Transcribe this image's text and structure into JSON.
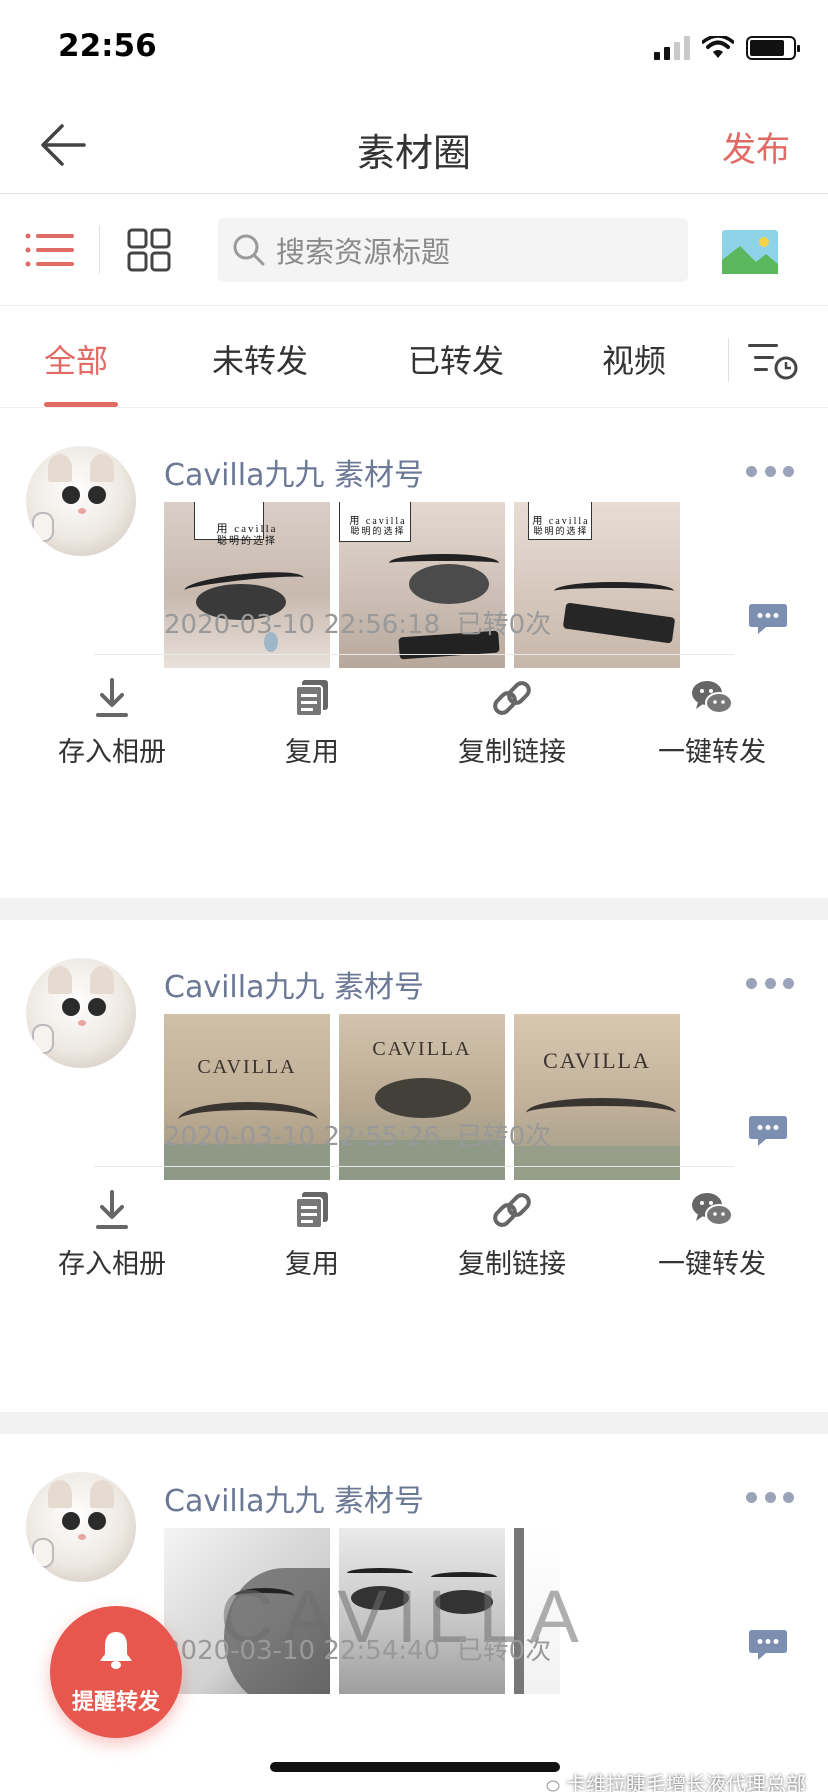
{
  "status_bar": {
    "time": "22:56"
  },
  "nav": {
    "title": "素材圈",
    "publish_label": "发布"
  },
  "search": {
    "placeholder": "搜索资源标题"
  },
  "tabs": [
    {
      "label": "全部",
      "active": true
    },
    {
      "label": "未转发",
      "active": false
    },
    {
      "label": "已转发",
      "active": false
    },
    {
      "label": "视频",
      "active": false
    }
  ],
  "actions": {
    "save_label": "存入相册",
    "reuse_label": "复用",
    "copy_link_label": "复制链接",
    "forward_label": "一键转发"
  },
  "posts": [
    {
      "author": "Cavilla九九 素材号",
      "time": "2020-03-10 22:56:18",
      "forwards": "已转0次",
      "images": [
        {
          "overlay_top": "用 cavilla",
          "overlay_bottom": "聪明的选择"
        },
        {
          "overlay_top": "用 cavilla",
          "overlay_bottom": "聪明的选择"
        },
        {
          "overlay_top": "用 cavilla",
          "overlay_bottom": "聪明的选择"
        }
      ]
    },
    {
      "author": "Cavilla九九 素材号",
      "time": "2020-03-10 22:55:26",
      "forwards": "已转0次",
      "images": [
        {
          "brand": "CAVILLA"
        },
        {
          "brand": "CAVILLA"
        },
        {
          "brand": "CAVILLA"
        }
      ]
    },
    {
      "author": "Cavilla九九 素材号",
      "time": "2020-03-10 22:54:40",
      "forwards": "已转0次",
      "brand_overlay": "CAVILLA"
    }
  ],
  "reminder": {
    "label": "提醒转发"
  },
  "watermark": {
    "text": "卡维拉睫毛增长液代理总部"
  },
  "colors": {
    "accent": "#e06b64",
    "author": "#6b7896",
    "reminder": "#e8574d"
  }
}
